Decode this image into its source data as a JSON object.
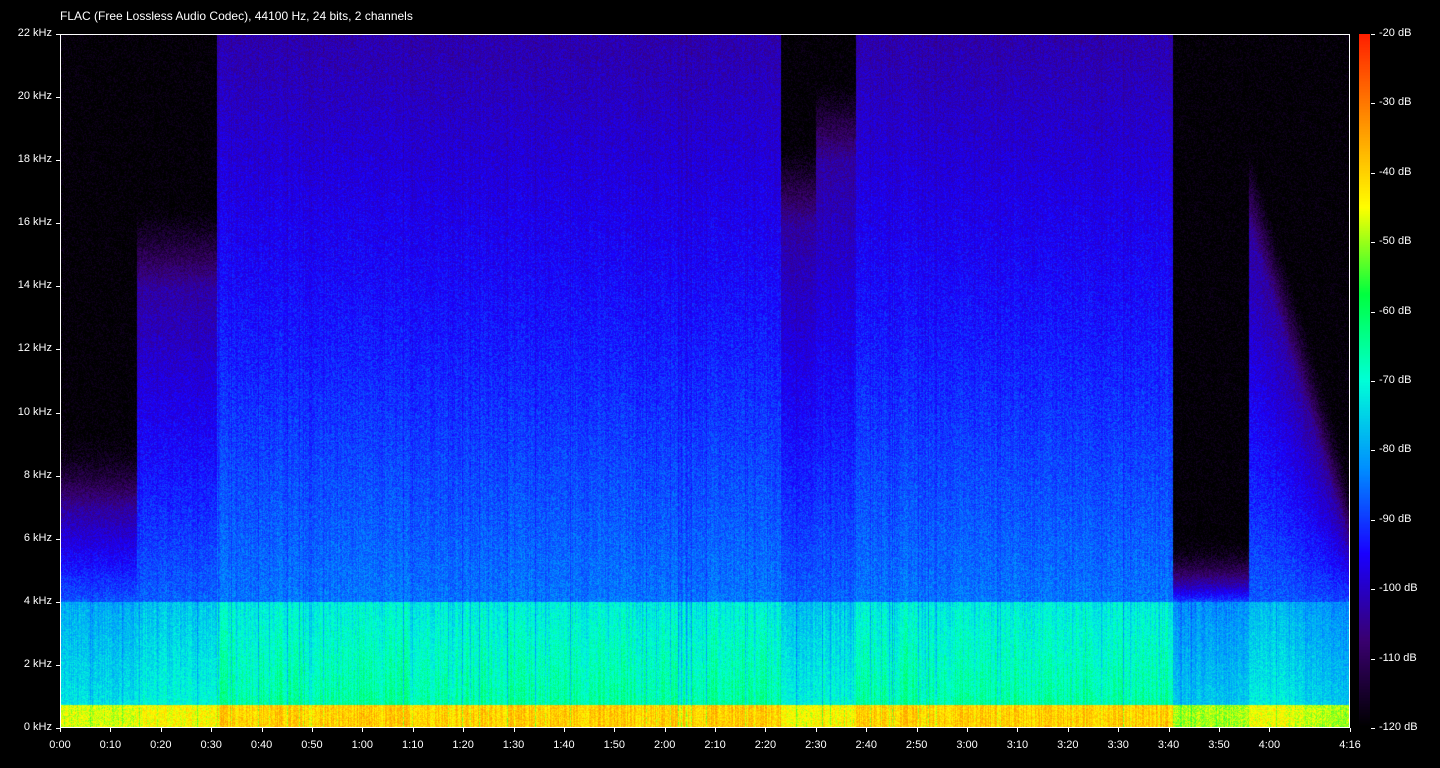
{
  "title": "FLAC (Free Lossless Audio Codec), 44100 Hz, 24 bits, 2 channels",
  "chart_data": {
    "type": "heatmap",
    "title": "FLAC (Free Lossless Audio Codec), 44100 Hz, 24 bits, 2 channels",
    "x_axis": {
      "unit": "time",
      "range_seconds": [
        0,
        256
      ],
      "tick_labels": [
        "0:00",
        "0:10",
        "0:20",
        "0:30",
        "0:40",
        "0:50",
        "1:00",
        "1:10",
        "1:20",
        "1:30",
        "1:40",
        "1:50",
        "2:00",
        "2:10",
        "2:20",
        "2:30",
        "2:40",
        "2:50",
        "3:00",
        "3:10",
        "3:20",
        "3:30",
        "3:40",
        "3:50",
        "4:00",
        "4:16"
      ],
      "tick_values_seconds": [
        0,
        10,
        20,
        30,
        40,
        50,
        60,
        70,
        80,
        90,
        100,
        110,
        120,
        130,
        140,
        150,
        160,
        170,
        180,
        190,
        200,
        210,
        220,
        230,
        240,
        256
      ]
    },
    "y_axis": {
      "unit": "kHz",
      "range": [
        0,
        22
      ],
      "tick_labels": [
        "0 kHz",
        "2 kHz",
        "4 kHz",
        "6 kHz",
        "8 kHz",
        "10 kHz",
        "12 kHz",
        "14 kHz",
        "16 kHz",
        "18 kHz",
        "20 kHz",
        "22 kHz"
      ],
      "tick_values": [
        0,
        2,
        4,
        6,
        8,
        10,
        12,
        14,
        16,
        18,
        20,
        22
      ]
    },
    "color_scale": {
      "unit": "dB",
      "range": [
        -120,
        -20
      ],
      "tick_labels": [
        "-20 dB",
        "-30 dB",
        "-40 dB",
        "-50 dB",
        "-60 dB",
        "-70 dB",
        "-80 dB",
        "-90 dB",
        "-100 dB",
        "-110 dB",
        "-120 dB"
      ],
      "tick_values": [
        -20,
        -30,
        -40,
        -50,
        -60,
        -70,
        -80,
        -90,
        -100,
        -110,
        -120
      ],
      "colormap": [
        "#000000",
        "#3a0070",
        "#1a00ff",
        "#0090ff",
        "#00ffd8",
        "#00ff40",
        "#ffff00",
        "#ff9000",
        "#ff2000"
      ]
    },
    "segments_seconds": [
      {
        "start": 0,
        "end": 15,
        "character": "sparse low-frequency notes, mostly below 7 kHz"
      },
      {
        "start": 15,
        "end": 31,
        "character": "moderate energy up to ~14 kHz"
      },
      {
        "start": 31,
        "end": 143,
        "character": "full-band dense content up to 22 kHz"
      },
      {
        "start": 143,
        "end": 150,
        "character": "quieter high band"
      },
      {
        "start": 150,
        "end": 158,
        "character": "moderate energy"
      },
      {
        "start": 158,
        "end": 221,
        "character": "full-band dense content up to 22 kHz"
      },
      {
        "start": 221,
        "end": 236,
        "character": "sparse low-frequency notes below 4 kHz"
      },
      {
        "start": 236,
        "end": 256,
        "character": "decaying fade-out"
      }
    ]
  }
}
